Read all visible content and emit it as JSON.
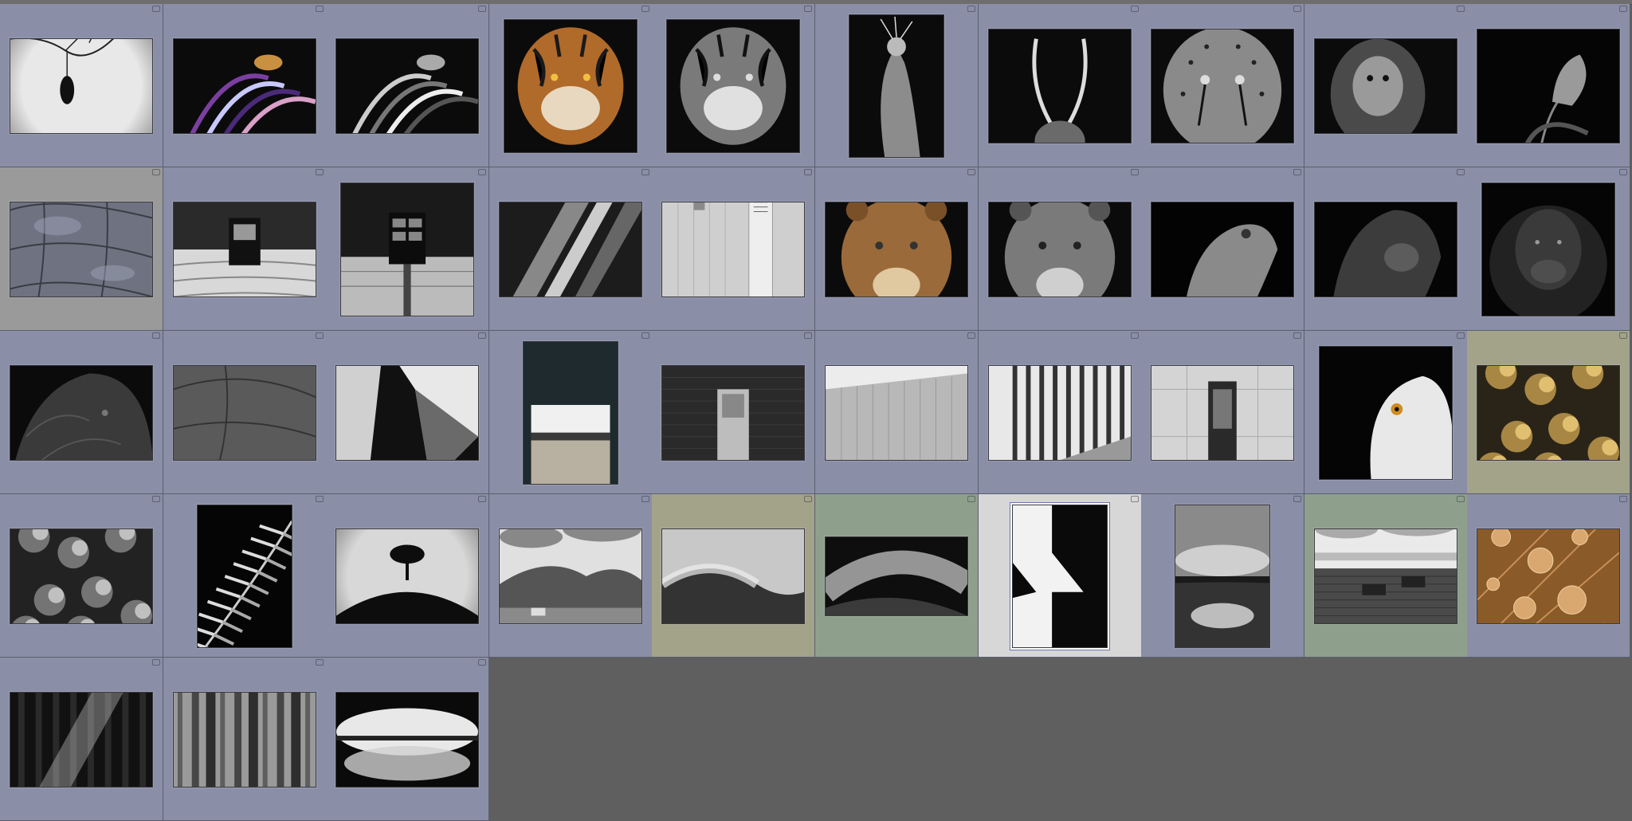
{
  "app": {
    "view": "grid-view",
    "columns": 10,
    "colors": {
      "cell_default": "#8a8fa7",
      "cell_gray": "#9a9a9a",
      "cell_olive": "#a3a38a",
      "cell_green": "#8ea08c",
      "cell_white": "#d7d7d7",
      "background": "#5f5f5f"
    }
  },
  "thumbnails": [
    {
      "subject": "bat-hanging-from-branch",
      "label": "red",
      "orient": "landscape",
      "bg": "cell_default"
    },
    {
      "subject": "lionfish-color",
      "label": "none",
      "orient": "landscape",
      "bg": "cell_default"
    },
    {
      "subject": "lionfish-bw",
      "label": "none",
      "orient": "landscape",
      "bg": "cell_default"
    },
    {
      "subject": "tiger-color",
      "label": "none",
      "orient": "portrait-sq",
      "bg": "cell_default"
    },
    {
      "subject": "tiger-bw",
      "label": "none",
      "orient": "portrait-sq",
      "bg": "cell_default"
    },
    {
      "subject": "crowned-crane",
      "label": "none",
      "orient": "portrait",
      "bg": "cell_default"
    },
    {
      "subject": "antelope-horns",
      "label": "none",
      "orient": "landscape-tall",
      "bg": "cell_default"
    },
    {
      "subject": "cheetah-face",
      "label": "none",
      "orient": "landscape-tall",
      "bg": "cell_default"
    },
    {
      "subject": "orangutan",
      "label": "none",
      "orient": "landscape",
      "bg": "cell_default"
    },
    {
      "subject": "tulip-dark",
      "label": "none",
      "orient": "landscape-tall",
      "bg": "cell_default"
    },
    {
      "subject": "elephant-skin-texture",
      "label": "none",
      "orient": "landscape",
      "bg": "cell_gray"
    },
    {
      "subject": "building-window-reflection",
      "label": "none",
      "orient": "landscape",
      "bg": "cell_default"
    },
    {
      "subject": "building-window-tall",
      "label": "none",
      "orient": "square",
      "bg": "cell_default"
    },
    {
      "subject": "diagonal-facade",
      "label": "none",
      "orient": "landscape",
      "bg": "cell_default"
    },
    {
      "subject": "white-wall-cylinder",
      "label": "none",
      "orient": "landscape",
      "bg": "cell_default"
    },
    {
      "subject": "lioness-color",
      "label": "none",
      "orient": "landscape",
      "bg": "cell_default"
    },
    {
      "subject": "lioness-bw",
      "label": "none",
      "orient": "landscape",
      "bg": "cell_default"
    },
    {
      "subject": "lioness-looking-up",
      "label": "none",
      "orient": "landscape",
      "bg": "cell_default"
    },
    {
      "subject": "gorilla-profile",
      "label": "none",
      "orient": "landscape",
      "bg": "cell_default"
    },
    {
      "subject": "gorilla-portrait",
      "label": "none",
      "orient": "square",
      "bg": "cell_default"
    },
    {
      "subject": "bison-dark",
      "label": "none",
      "orient": "landscape",
      "bg": "cell_default"
    },
    {
      "subject": "rhino-skin",
      "label": "none",
      "orient": "landscape",
      "bg": "cell_default"
    },
    {
      "subject": "abstract-angles",
      "label": "none",
      "orient": "landscape",
      "bg": "cell_default"
    },
    {
      "subject": "doorway-landscape",
      "label": "none",
      "orient": "portrait",
      "bg": "cell_default"
    },
    {
      "subject": "brick-door",
      "label": "none",
      "orient": "landscape",
      "bg": "cell_default"
    },
    {
      "subject": "long-wall-building",
      "label": "none",
      "orient": "landscape",
      "bg": "cell_default"
    },
    {
      "subject": "glass-columns",
      "label": "none",
      "orient": "landscape",
      "bg": "cell_default"
    },
    {
      "subject": "building-door-facade",
      "label": "none",
      "orient": "landscape",
      "bg": "cell_default"
    },
    {
      "subject": "snowy-owl",
      "label": "none",
      "orient": "square",
      "bg": "cell_default"
    },
    {
      "subject": "lichen-gold",
      "label": "none",
      "orient": "landscape",
      "bg": "cell_olive"
    },
    {
      "subject": "lichen-bw",
      "label": "none",
      "orient": "landscape",
      "bg": "cell_default"
    },
    {
      "subject": "fern-leaf",
      "label": "none",
      "orient": "portrait",
      "bg": "cell_default"
    },
    {
      "subject": "lone-tree-hill",
      "label": "none",
      "orient": "landscape",
      "bg": "cell_default"
    },
    {
      "subject": "highland-landscape",
      "label": "none",
      "orient": "landscape",
      "bg": "cell_default"
    },
    {
      "subject": "misty-hill",
      "label": "none",
      "orient": "landscape",
      "bg": "cell_olive"
    },
    {
      "subject": "stormy-hill",
      "label": "none",
      "orient": "landscape-short",
      "bg": "cell_green"
    },
    {
      "subject": "white-chevron-abstract",
      "label": "none",
      "orient": "portrait",
      "bg": "cell_white",
      "active": true
    },
    {
      "subject": "beach-reflection",
      "label": "none",
      "orient": "portrait",
      "bg": "cell_default"
    },
    {
      "subject": "deck-chairs-pier",
      "label": "none",
      "orient": "landscape",
      "bg": "cell_green"
    },
    {
      "subject": "leaf-water-drops",
      "label": "none",
      "orient": "landscape",
      "bg": "cell_default"
    },
    {
      "subject": "forest-sunbeams",
      "label": "none",
      "orient": "landscape",
      "bg": "cell_default"
    },
    {
      "subject": "misty-forest",
      "label": "none",
      "orient": "landscape",
      "bg": "cell_default"
    },
    {
      "subject": "lake-reflection-glow",
      "label": "none",
      "orient": "landscape",
      "bg": "cell_default"
    }
  ]
}
